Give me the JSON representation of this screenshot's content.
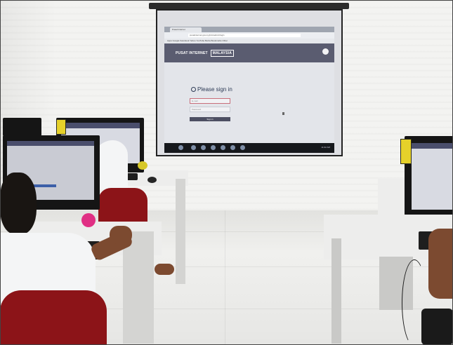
{
  "projected_page": {
    "browser_tab": "Pusat Internet",
    "address": "pusatinternet.gov.my/pim/admin/login",
    "bookmarks": "Apps   Google   Facebook   Yahoo   YouTube   Berita   Bookmarks   Other",
    "brand_left": "PUSAT INTERNET",
    "brand_right": "MALAYSIA",
    "signin_title": "Please sign in",
    "email_placeholder": "E-mail",
    "password_placeholder": "Password",
    "signin_button": "Sign in",
    "taskbar_clock": "11:02 AM"
  },
  "colors": {
    "site_header": "#5a5c70",
    "chair_red": "#8c1418",
    "sticker_yellow": "#e6d12a"
  }
}
